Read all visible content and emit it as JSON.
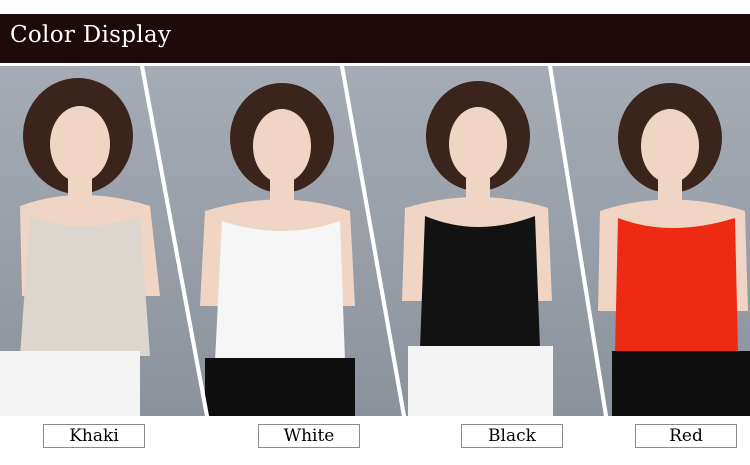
{
  "header": {
    "title": "Color Display"
  },
  "variants": [
    {
      "label": "Khaki",
      "color": "#ddd6cf"
    },
    {
      "label": "White",
      "color": "#f6f6f6"
    },
    {
      "label": "Black",
      "color": "#121212"
    },
    {
      "label": "Red",
      "color": "#ee2a12"
    }
  ],
  "colors": {
    "header_bg": "#1f0a0b",
    "photo_bg": "#9aa0a8",
    "skin": "#f1d5c4",
    "hair": "#3b241b",
    "black_pants": "#0f0f0f",
    "white_pants": "#f4f4f4"
  }
}
